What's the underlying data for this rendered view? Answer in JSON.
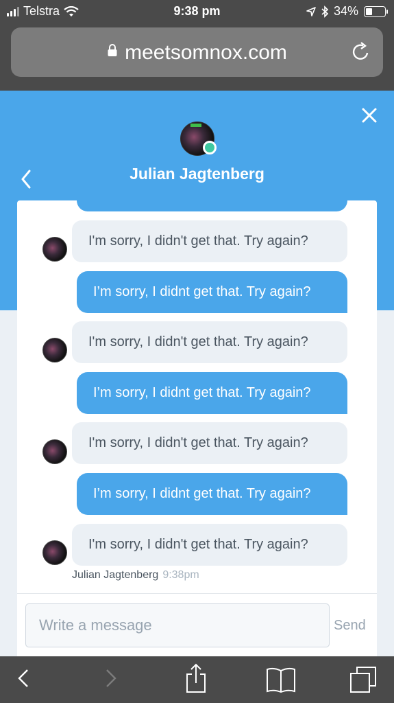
{
  "status_bar": {
    "carrier": "Telstra",
    "time": "9:38 pm",
    "battery": "34%",
    "battery_level": 0.34
  },
  "browser": {
    "domain": "meetsomnox.com"
  },
  "chat": {
    "contact_name": "Julian Jagtenberg",
    "messages": [
      {
        "sender": "bot",
        "text": "I'm sorry, I didn't get that. Try again?"
      },
      {
        "sender": "user",
        "text": "I’m sorry, I didnt get that. Try again?"
      },
      {
        "sender": "bot",
        "text": "I'm sorry, I didn't get that. Try again?"
      },
      {
        "sender": "user",
        "text": "I’m sorry, I didnt get that. Try again?"
      },
      {
        "sender": "bot",
        "text": "I'm sorry, I didn't get that. Try again?"
      },
      {
        "sender": "user",
        "text": "I’m sorry, I didnt get that. Try again?"
      },
      {
        "sender": "bot",
        "text": "I'm sorry, I didn't get that. Try again?"
      }
    ],
    "last_message_author": "Julian Jagtenberg",
    "last_message_time": "9:38pm",
    "input_placeholder": "Write a message",
    "send_label": "Send"
  },
  "colors": {
    "accent": "#4aa6ea",
    "bot_bubble": "#ebf0f5",
    "online": "#3fc8a0"
  },
  "icons": [
    "signal-icon",
    "wifi-icon",
    "location-icon",
    "bluetooth-icon",
    "battery-icon",
    "lock-icon",
    "reload-icon",
    "close-icon",
    "back-chevron-icon",
    "browser-back-icon",
    "browser-forward-icon",
    "share-icon",
    "bookmarks-icon",
    "tabs-icon"
  ]
}
